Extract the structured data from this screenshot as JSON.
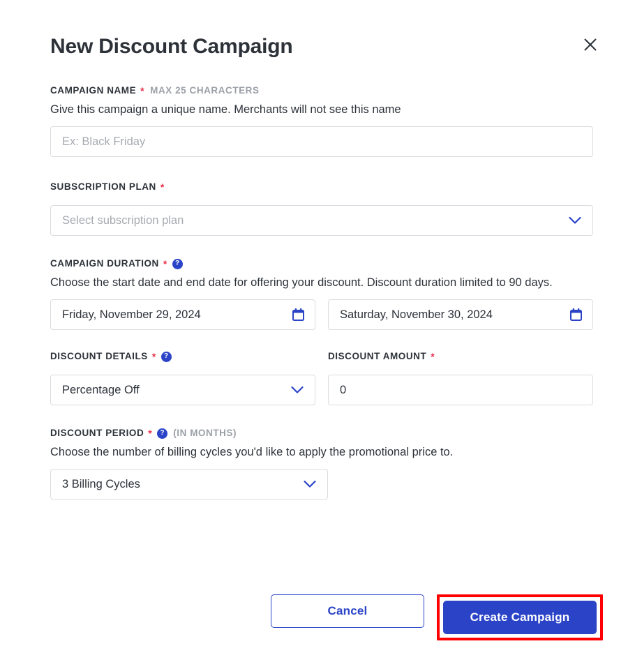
{
  "modal": {
    "title": "New Discount Campaign",
    "close_icon": "close-icon"
  },
  "colors": {
    "accent": "#2b44c7",
    "required": "#e8304a",
    "text": "#2d3239",
    "muted": "#9b9fa6",
    "border": "#d9dce0",
    "highlight": "#ff0000"
  },
  "fields": {
    "campaign_name": {
      "label": "CAMPAIGN NAME",
      "required_mark": "*",
      "suffix": "MAX 25 CHARACTERS",
      "description": "Give this campaign a unique name. Merchants will not see this name",
      "placeholder": "Ex: Black Friday",
      "value": ""
    },
    "subscription_plan": {
      "label": "SUBSCRIPTION PLAN",
      "required_mark": "*",
      "placeholder": "Select subscription plan",
      "value": "",
      "chevron_icon": "chevron-down-icon"
    },
    "campaign_duration": {
      "label": "CAMPAIGN DURATION",
      "required_mark": "*",
      "help_icon": "help-icon",
      "help_glyph": "?",
      "description": "Choose the start date and end date for offering your discount. Discount duration limited to 90 days.",
      "start_date": "Friday, November 29, 2024",
      "end_date": "Saturday, November 30, 2024",
      "calendar_icon": "calendar-icon"
    },
    "discount_details": {
      "label": "DISCOUNT DETAILS",
      "required_mark": "*",
      "help_icon": "help-icon",
      "help_glyph": "?",
      "value": "Percentage Off",
      "chevron_icon": "chevron-down-icon"
    },
    "discount_amount": {
      "label": "DISCOUNT AMOUNT",
      "required_mark": "*",
      "value": "0",
      "placeholder": "0"
    },
    "discount_period": {
      "label": "DISCOUNT PERIOD",
      "required_mark": "*",
      "help_icon": "help-icon",
      "help_glyph": "?",
      "suffix": "(IN MONTHS)",
      "description": "Choose the number of billing cycles you'd like to apply the promotional price to.",
      "value": "3 Billing Cycles",
      "chevron_icon": "chevron-down-icon"
    }
  },
  "footer": {
    "cancel_label": "Cancel",
    "submit_label": "Create Campaign"
  }
}
